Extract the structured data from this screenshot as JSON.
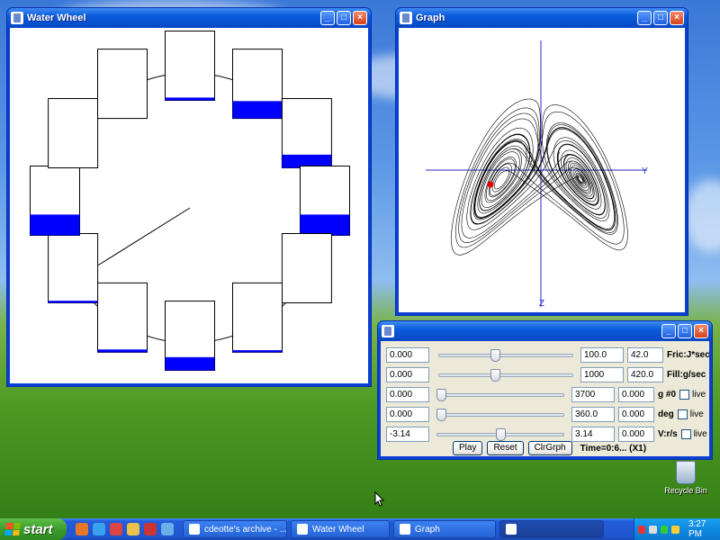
{
  "water_wheel_window": {
    "title": "Water Wheel",
    "buckets": [
      {
        "fill": 0.04
      },
      {
        "fill": 0.25
      },
      {
        "fill": 0.19
      },
      {
        "fill": 0.3
      },
      {
        "fill": 0.0
      },
      {
        "fill": 0.03
      },
      {
        "fill": 0.19
      },
      {
        "fill": 0.04
      },
      {
        "fill": 0.03
      },
      {
        "fill": 0.3
      },
      {
        "fill": 0.0
      },
      {
        "fill": 0.0
      }
    ]
  },
  "graph_window": {
    "title": "Graph",
    "axis_y_label": "Y",
    "axis_z_label": "Z"
  },
  "control_panel": {
    "title": "",
    "rows": [
      {
        "min": "0.000",
        "max": "100.0",
        "value": "42.0",
        "label": "Fric:J*sec",
        "slider": 0.42,
        "has_live": false
      },
      {
        "min": "0.000",
        "max": "1000",
        "value": "420.0",
        "label": "Fill:g/sec",
        "slider": 0.42,
        "has_live": false
      },
      {
        "min": "0.000",
        "max": "3700",
        "value": "0.000",
        "label": "g #0",
        "slider": 0.0,
        "has_live": true,
        "live_label": "live"
      },
      {
        "min": "0.000",
        "max": "360.0",
        "value": "0.000",
        "label": "deg",
        "slider": 0.0,
        "has_live": true,
        "live_label": "live"
      },
      {
        "min": "-3.14",
        "max": "3.14",
        "value": "0.000",
        "label": "V:r/s",
        "slider": 0.5,
        "has_live": true,
        "live_label": "live"
      }
    ],
    "buttons": {
      "play": "Play",
      "reset": "Reset",
      "clear_graph": "ClrGrph"
    },
    "status": "Time=0:6...  (X1)"
  },
  "desktop": {
    "recycle_bin_label": "Recycle Bin"
  },
  "taskbar": {
    "start_label": "start",
    "tasks": [
      {
        "label": "cdeotte's archive - ...",
        "active": false
      },
      {
        "label": "Water Wheel",
        "active": false
      },
      {
        "label": "Graph",
        "active": false
      },
      {
        "label": "",
        "active": true
      }
    ],
    "clock": "3:27 PM"
  },
  "colors": {
    "bucket_fill": "#0000ff",
    "trajectory": "#000000",
    "axis": "#2a2ad0",
    "marker": "#e00000"
  }
}
